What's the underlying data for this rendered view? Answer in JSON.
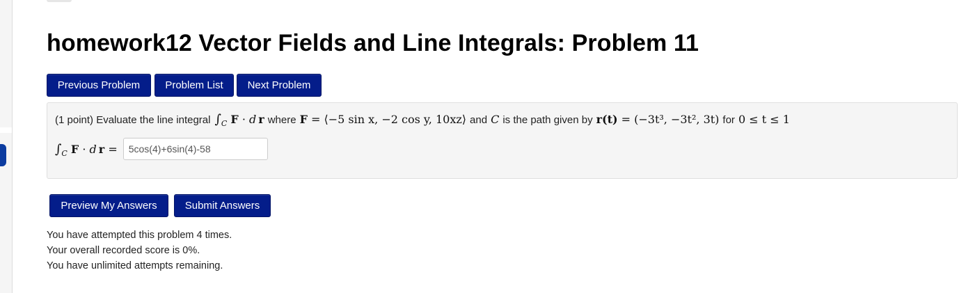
{
  "page": {
    "title": "homework12 Vector Fields and Line Integrals: Problem 11"
  },
  "nav": {
    "previous_label": "Previous Problem",
    "list_label": "Problem List",
    "next_label": "Next Problem"
  },
  "problem": {
    "points": "(1 point) Evaluate the line integral",
    "word_where": "where",
    "word_and": "and",
    "word_path": "is the path given by",
    "word_for": "for",
    "math": {
      "integral_sub": "C",
      "F": "F",
      "dr_d": "d",
      "dr_r": "r",
      "F_def": "⟨−5 sin x, −2 cos y, 10xz⟩",
      "C": "C",
      "r_of_t": "r(t)",
      "r_def": "(−3t³, −3t², 3t)",
      "range": "0 ≤ t ≤ 1"
    },
    "answer_prefix_eq": "=",
    "answer_value": "5cos(4)+6sin(4)-58"
  },
  "actions": {
    "preview_label": "Preview My Answers",
    "submit_label": "Submit Answers"
  },
  "status": {
    "attempts": "You have attempted this problem 4 times.",
    "score": "Your overall recorded score is 0%.",
    "remaining": "You have unlimited attempts remaining."
  },
  "colors": {
    "button_bg": "#041d8a",
    "panel_bg": "#f5f5f5",
    "rail_tab": "#0c3ca0"
  }
}
